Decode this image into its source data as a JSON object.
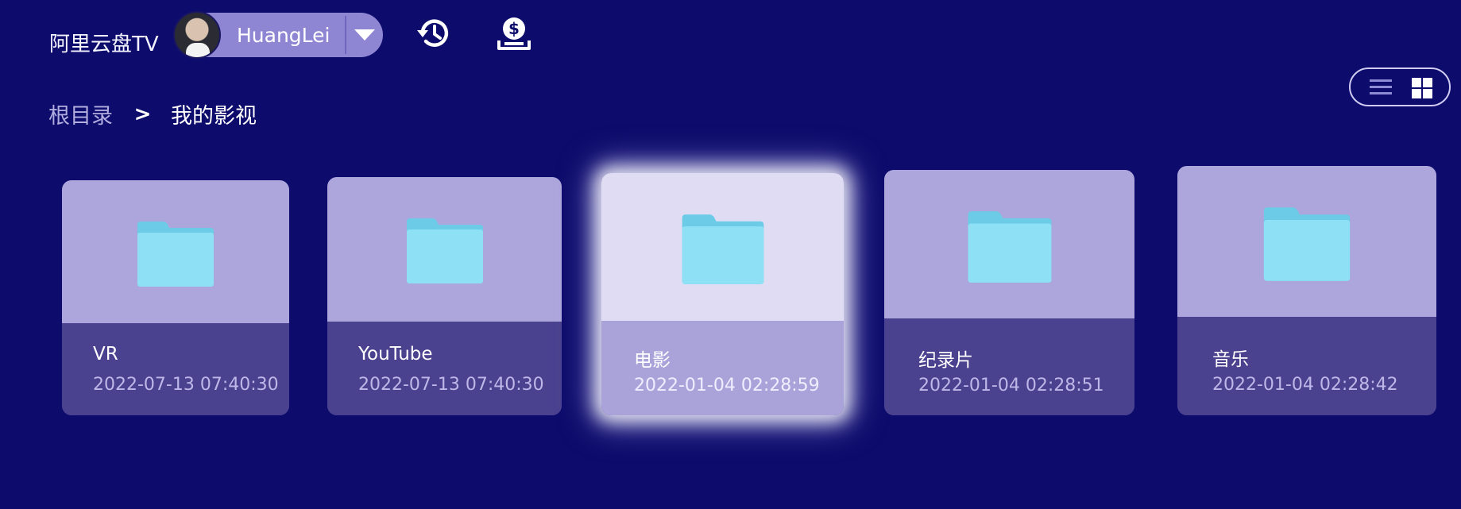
{
  "header": {
    "app_title": "阿里云盘TV",
    "user_name": "HuangLei"
  },
  "breadcrumb": {
    "root": "根目录",
    "separator": ">",
    "current": "我的影视"
  },
  "view_toggle": {
    "options": [
      "list",
      "grid"
    ],
    "selected": "grid"
  },
  "folders": [
    {
      "name": "VR",
      "date": "2022-07-13 07:40:30"
    },
    {
      "name": "YouTube",
      "date": "2022-07-13 07:40:30"
    },
    {
      "name": "电影",
      "date": "2022-01-04 02:28:59",
      "focused": true
    },
    {
      "name": "纪录片",
      "date": "2022-01-04 02:28:51"
    },
    {
      "name": "音乐",
      "date": "2022-01-04 02:28:42"
    }
  ],
  "icons": {
    "history": "history-icon",
    "money": "money-icon",
    "folder": "folder-icon",
    "dropdown": "chevron-down-icon"
  },
  "colors": {
    "background": "#0d0b6b",
    "card_top": "#ada6dc",
    "card_bottom": "#4a418f",
    "folder": "#8ee0f4",
    "focus_top": "#dfdcf4"
  }
}
